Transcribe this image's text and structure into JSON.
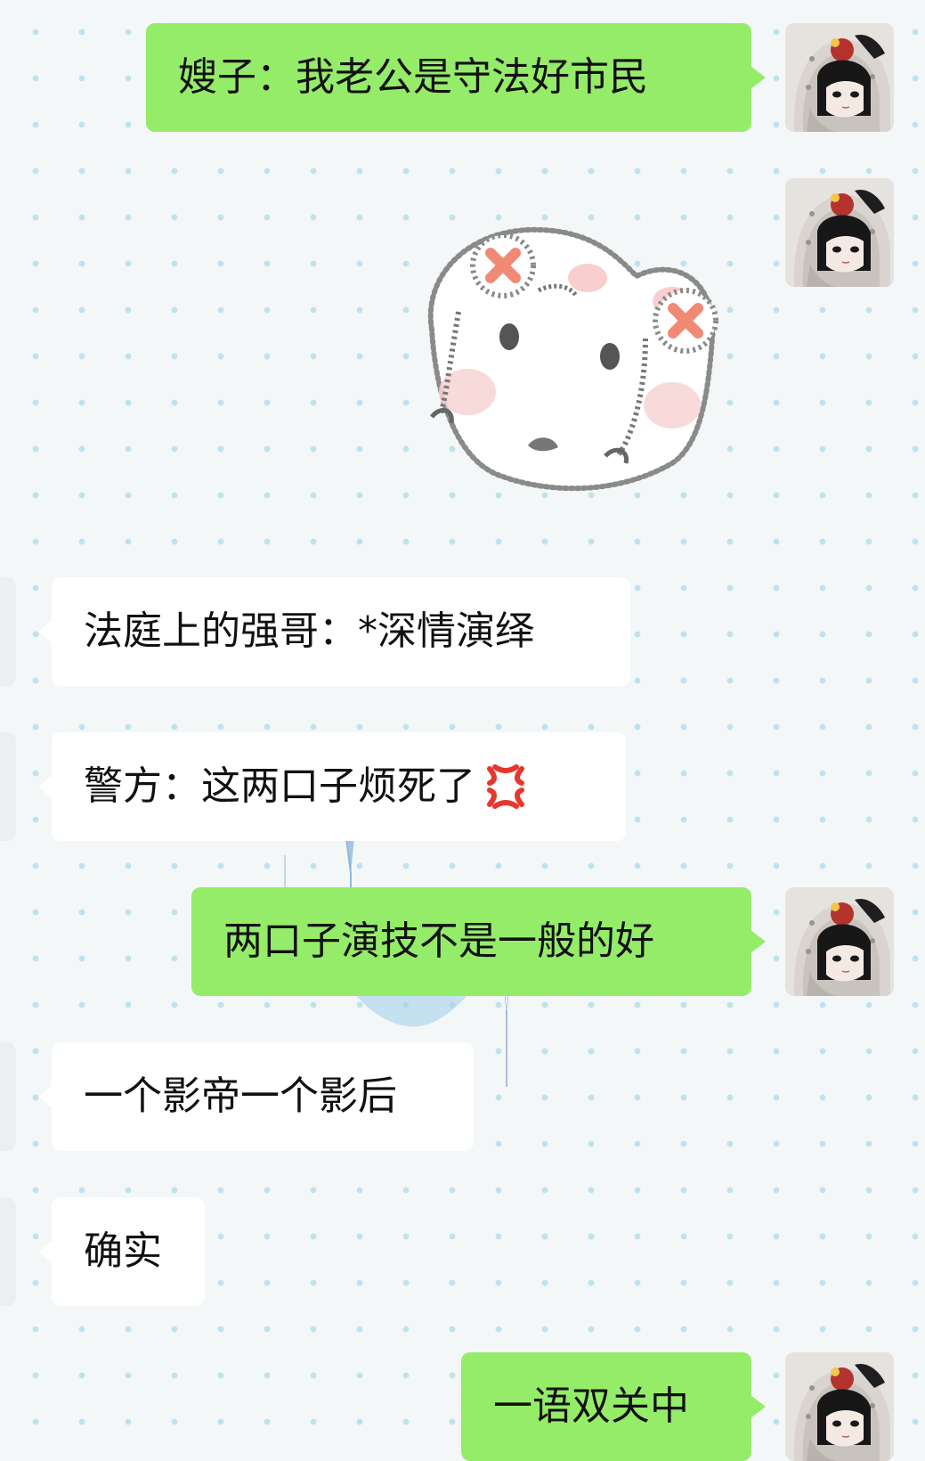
{
  "messages": [
    {
      "side": "out",
      "text": "嫂子：我老公是守法好市民"
    },
    {
      "side": "out",
      "type": "sticker",
      "sticker_icon": "angry-bunny-sticker"
    },
    {
      "side": "in",
      "text": "法庭上的强哥：*深情演绎"
    },
    {
      "side": "in",
      "text": "警方：这两口子烦死了",
      "emoji": "anger-symbol-emoji"
    },
    {
      "side": "out",
      "text": "两口子演技不是一般的好"
    },
    {
      "side": "in",
      "text": "一个影帝一个影后"
    },
    {
      "side": "in",
      "text": "确实"
    },
    {
      "side": "out",
      "text": "一语双关中"
    }
  ],
  "colors": {
    "outgoing_bubble": "#95ec69",
    "incoming_bubble": "#ffffff",
    "background": "#f4f7f8",
    "background_dots": "#bfe3ee",
    "anger_emoji": "#e8362d"
  },
  "icons": {
    "self_avatar": "chibi-girl-avatar",
    "background_decoration": "blue-lily-sparkle"
  }
}
